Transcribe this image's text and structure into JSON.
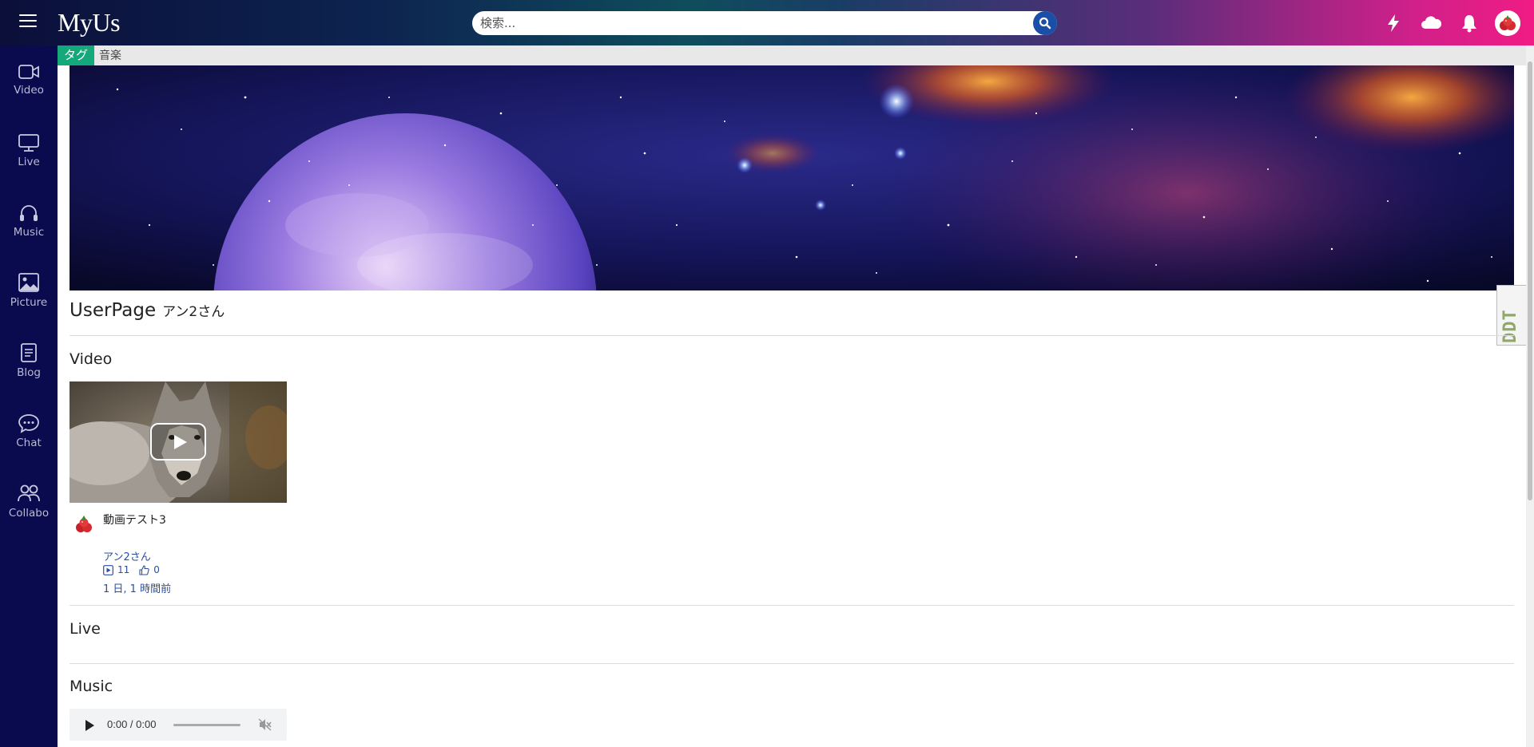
{
  "header": {
    "logo": "MyUs",
    "search_placeholder": "検索...",
    "icons": [
      "lightning-icon",
      "cloud-icon",
      "bell-icon",
      "user-avatar"
    ]
  },
  "sidebar": {
    "items": [
      {
        "label": "Video",
        "icon": "video-camera-icon"
      },
      {
        "label": "Live",
        "icon": "monitor-icon"
      },
      {
        "label": "Music",
        "icon": "headphones-icon"
      },
      {
        "label": "Picture",
        "icon": "image-icon"
      },
      {
        "label": "Blog",
        "icon": "document-icon"
      },
      {
        "label": "Chat",
        "icon": "chat-bubble-icon"
      },
      {
        "label": "Collabo",
        "icon": "people-icon"
      }
    ]
  },
  "tagbar": {
    "label": "タグ",
    "value": "音楽"
  },
  "page": {
    "title": "UserPage",
    "username": "アン2さん"
  },
  "sections": {
    "video": "Video",
    "live": "Live",
    "music": "Music"
  },
  "video_card": {
    "title": "動画テスト3",
    "author": "アン2さん",
    "views": "11",
    "likes": "0",
    "time": "1 日, 1 時間前"
  },
  "audio_player": {
    "time": "0:00 / 0:00"
  },
  "extension_badge": "DDT",
  "colors": {
    "sidebar_bg": "#0a0a4e",
    "tag_green": "#13a97a",
    "link_blue": "#2a4fa0",
    "search_button": "#1a4fa8"
  }
}
